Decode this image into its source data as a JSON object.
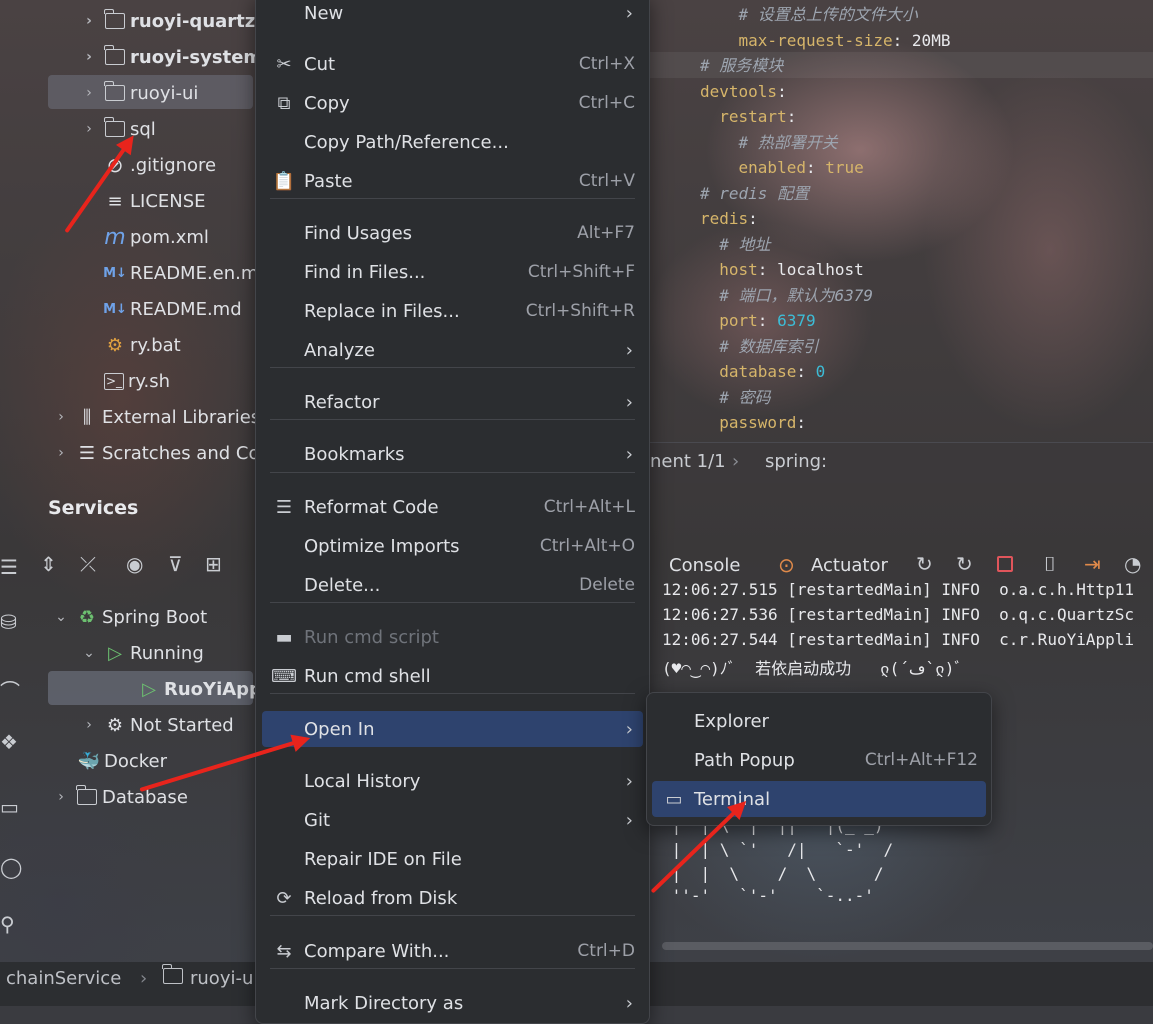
{
  "project_tree": {
    "items": [
      {
        "label": "ruoyi-quartz",
        "type": "module"
      },
      {
        "label": "ruoyi-system",
        "type": "module"
      },
      {
        "label": "ruoyi-ui",
        "type": "folder"
      },
      {
        "label": "sql",
        "type": "folder"
      },
      {
        "label": ".gitignore",
        "type": "file"
      },
      {
        "label": "LICENSE",
        "type": "file"
      },
      {
        "label": "pom.xml",
        "type": "maven"
      },
      {
        "label": "README.en.md",
        "type": "markdown"
      },
      {
        "label": "README.md",
        "type": "markdown"
      },
      {
        "label": "ry.bat",
        "type": "script"
      },
      {
        "label": "ry.sh",
        "type": "shell"
      },
      {
        "label": "External Libraries",
        "type": "libraries"
      },
      {
        "label": "Scratches and Consoles",
        "type": "scratches"
      }
    ]
  },
  "services": {
    "title": "Services",
    "tree": [
      {
        "label": "Spring Boot"
      },
      {
        "label": "Running"
      },
      {
        "label": "RuoYiApplication"
      },
      {
        "label": "Not Started"
      },
      {
        "label": "Docker"
      },
      {
        "label": "Database"
      }
    ]
  },
  "editor": {
    "lines": [
      {
        "indent": "    ",
        "comment": "# 设置总上传的文件大小"
      },
      {
        "indent": "    ",
        "key": "max-request-size",
        "value": "20MB"
      },
      {
        "indent": "",
        "comment": "# 服务模块"
      },
      {
        "indent": "",
        "key": "devtools",
        "value": ""
      },
      {
        "indent": "  ",
        "key": "restart",
        "value": ""
      },
      {
        "indent": "    ",
        "comment": "# 热部署开关"
      },
      {
        "indent": "    ",
        "key": "enabled",
        "value": "true"
      },
      {
        "indent": "",
        "comment": "# redis 配置"
      },
      {
        "indent": "",
        "key": "redis",
        "value": ""
      },
      {
        "indent": "  ",
        "comment": "# 地址"
      },
      {
        "indent": "  ",
        "key": "host",
        "value": "localhost"
      },
      {
        "indent": "  ",
        "comment": "# 端口，默认为6379"
      },
      {
        "indent": "  ",
        "key": "port",
        "value": "6379"
      },
      {
        "indent": "  ",
        "comment": "# 数据库索引"
      },
      {
        "indent": "  ",
        "key": "database",
        "value": "0"
      },
      {
        "indent": "  ",
        "comment": "# 密码"
      },
      {
        "indent": "  ",
        "key": "password",
        "value": ""
      }
    ],
    "breadcrumb": {
      "document": "nent 1/1",
      "path": "spring:"
    }
  },
  "console": {
    "tabs": {
      "console": "Console",
      "actuator": "Actuator"
    },
    "log_lines": [
      "12:06:27.515 [restartedMain] INFO  o.a.c.h.Http11",
      "12:06:27.536 [restartedMain] INFO  o.q.c.QuartzSc",
      "12:06:27.544 [restartedMain] INFO  c.r.RuoYiAppli",
      "(♥◠‿◠)ﾉﾞ  若依启动成功   ლ(´ڡ`ლ)ﾞ"
    ],
    "ascii_art": [
      " |  | \\  |  ||   |(_ _)",
      " |  | \\ `'   /|   `-'  /",
      " |  |  \\    /  \\      /",
      " ''-'   `'-'    `-..-'"
    ]
  },
  "context_menu": {
    "items": [
      {
        "label": "New",
        "arrow": true
      },
      {
        "label": "Cut",
        "shortcut": "Ctrl+X",
        "icon": "scissors-icon"
      },
      {
        "label": "Copy",
        "shortcut": "Ctrl+C",
        "icon": "copy-icon"
      },
      {
        "label": "Copy Path/Reference..."
      },
      {
        "label": "Paste",
        "shortcut": "Ctrl+V",
        "icon": "paste-icon"
      },
      {
        "label": "Find Usages",
        "shortcut": "Alt+F7"
      },
      {
        "label": "Find in Files...",
        "shortcut": "Ctrl+Shift+F"
      },
      {
        "label": "Replace in Files...",
        "shortcut": "Ctrl+Shift+R"
      },
      {
        "label": "Analyze",
        "arrow": true
      },
      {
        "label": "Refactor",
        "arrow": true
      },
      {
        "label": "Bookmarks",
        "arrow": true
      },
      {
        "label": "Reformat Code",
        "shortcut": "Ctrl+Alt+L",
        "icon": "reformat-icon"
      },
      {
        "label": "Optimize Imports",
        "shortcut": "Ctrl+Alt+O"
      },
      {
        "label": "Delete...",
        "shortcut": "Delete"
      },
      {
        "label": "Run cmd script",
        "disabled": true,
        "icon": "cmd-script-icon"
      },
      {
        "label": "Run cmd shell",
        "icon": "cmd-shell-icon"
      },
      {
        "label": "Open In",
        "arrow": true,
        "selected": true
      },
      {
        "label": "Local History",
        "arrow": true
      },
      {
        "label": "Git",
        "arrow": true
      },
      {
        "label": "Repair IDE on File"
      },
      {
        "label": "Reload from Disk",
        "icon": "reload-icon"
      },
      {
        "label": "Compare With...",
        "shortcut": "Ctrl+D",
        "icon": "compare-icon"
      },
      {
        "label": "Mark Directory as",
        "arrow": true
      }
    ]
  },
  "open_in_submenu": {
    "items": [
      {
        "label": "Explorer"
      },
      {
        "label": "Path Popup",
        "shortcut": "Ctrl+Alt+F12"
      },
      {
        "label": "Terminal",
        "selected": true,
        "icon": "terminal-icon"
      }
    ]
  },
  "status_bar": {
    "crumbs": [
      "chainService",
      "ruoyi-ui"
    ]
  },
  "colors": {
    "menu_bg": "#2b2d30",
    "menu_selected": "#2e436e",
    "annotation_arrow": "#e8241c",
    "yaml_key": "#d6b56a",
    "yaml_number": "#3dbcd6"
  }
}
